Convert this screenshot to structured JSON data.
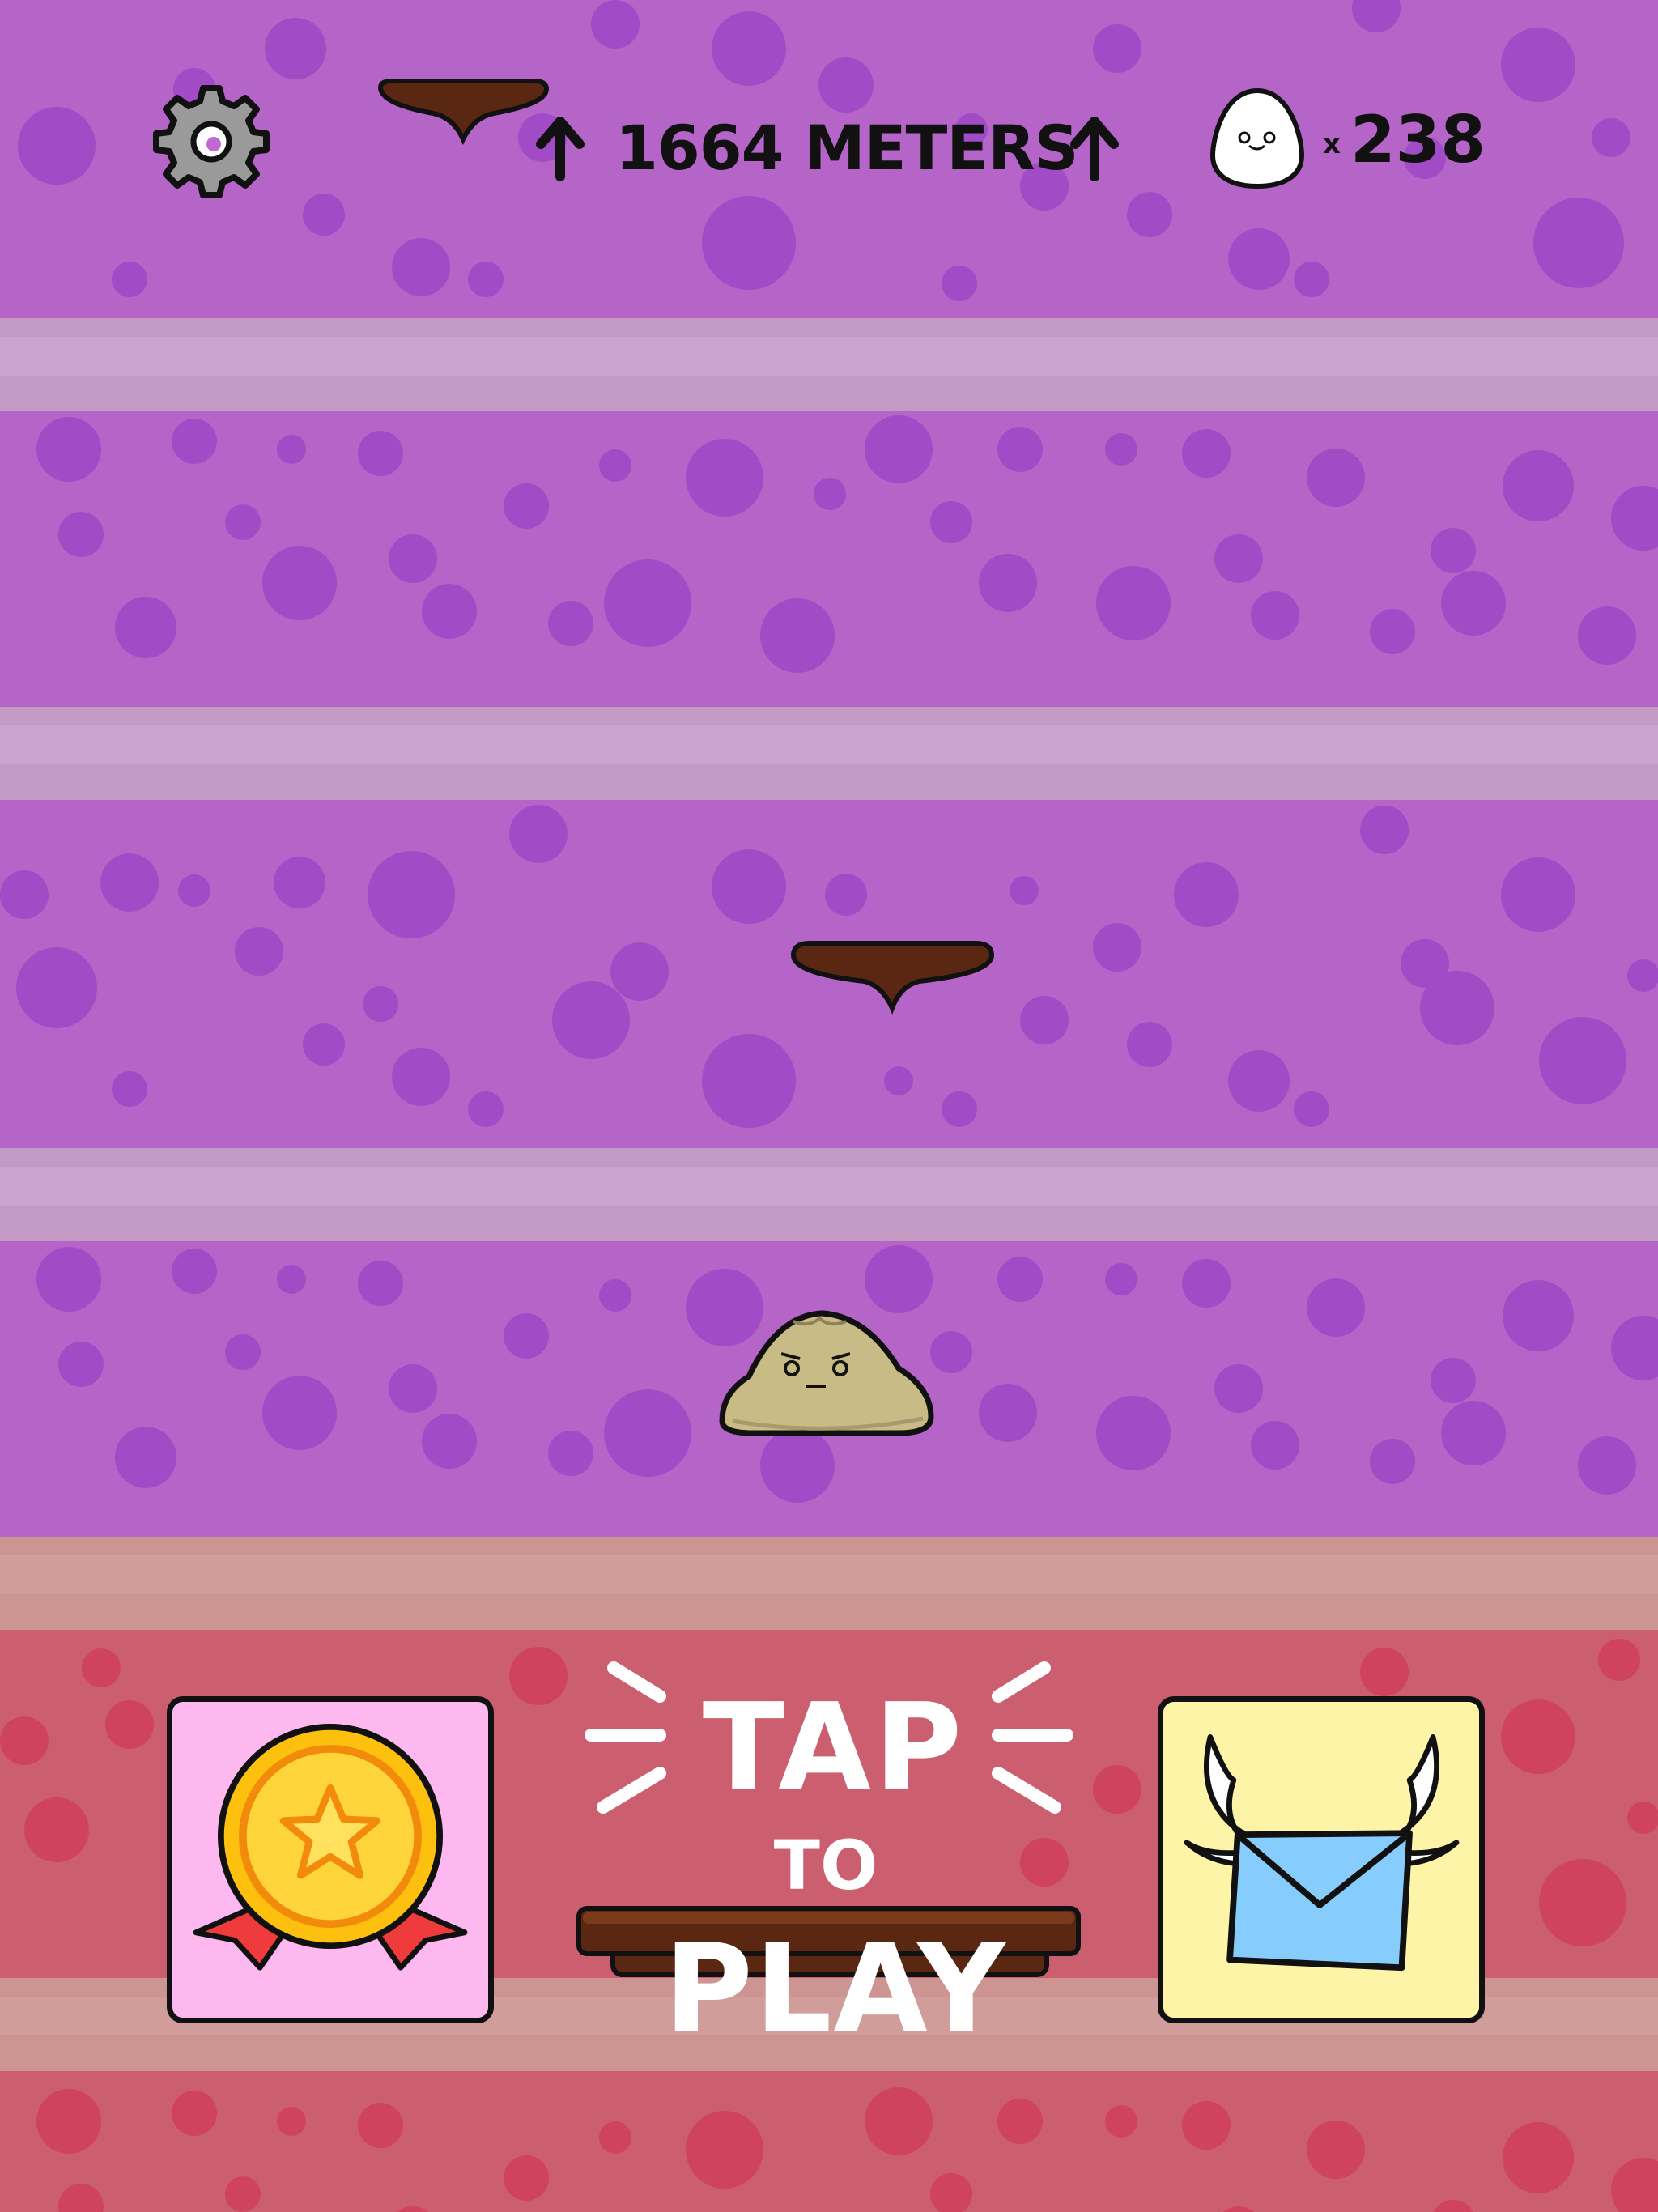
{
  "hud": {
    "distance_label": "1664 METERS",
    "egg_multiplier": "x",
    "egg_count": "238"
  },
  "start_prompt": {
    "line1": "TAP",
    "line2": "TO",
    "line3": "PLAY"
  },
  "icons": {
    "settings": "gear-icon",
    "achievements": "medal-icon",
    "mail": "winged-envelope-icon",
    "egg": "egg-icon",
    "arrow": "up-arrow-icon"
  },
  "colors": {
    "background_purple": "#b565c8",
    "spots_purple": "#a24bc6",
    "band_purple": "#c39ac4",
    "background_red": "#cc5f6f",
    "spots_red": "#d0435f",
    "platform": "#5a2712",
    "achievements_bg": "#fdb9ef",
    "mail_bg": "#fef4a8",
    "prompt_text": "#ffffff"
  }
}
